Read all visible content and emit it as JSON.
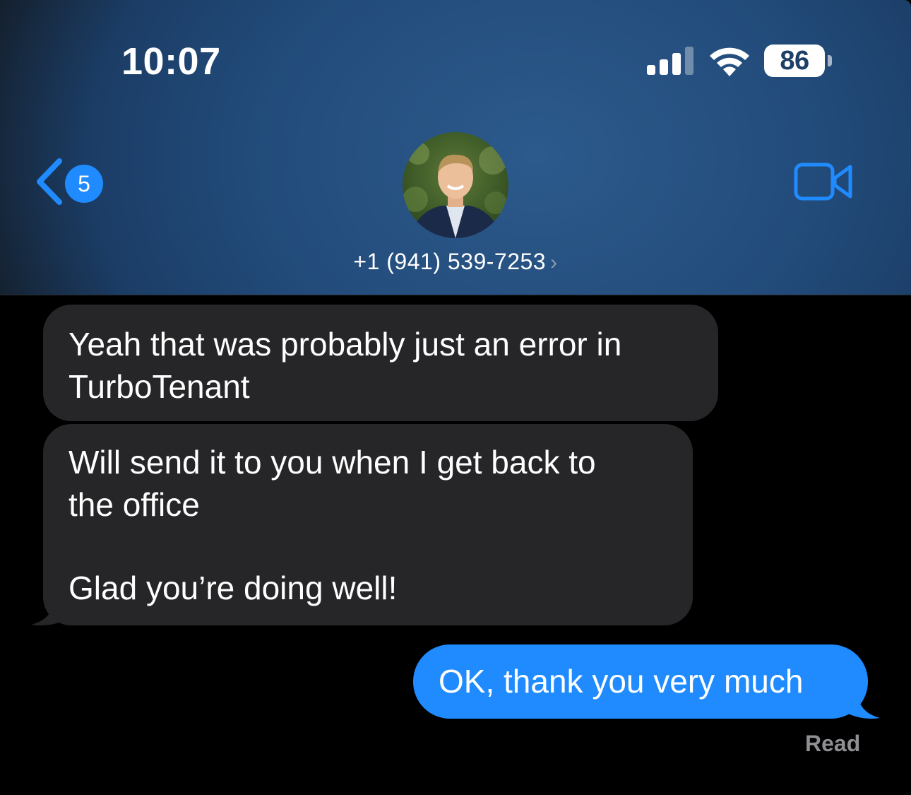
{
  "status_bar": {
    "time": "10:07",
    "battery_level": "86",
    "icons": [
      "signal-icon",
      "wifi-icon",
      "battery-icon"
    ]
  },
  "nav": {
    "back_badge_count": "5",
    "contact": "+1 (941) 539-7253",
    "contact_chevron": "›",
    "icons": [
      "back-chevron-icon",
      "video-call-icon",
      "contact-avatar"
    ]
  },
  "messages": [
    {
      "direction": "incoming",
      "lines": [
        "Yeah that was probably just an error in",
        "TurboTenant"
      ]
    },
    {
      "direction": "incoming",
      "paragraph1": [
        "Will send it to you when I get back to",
        "the office"
      ],
      "paragraph2": "Glad you’re doing well!"
    },
    {
      "direction": "outgoing",
      "text": "OK, thank you very much",
      "receipt": "Read"
    }
  ],
  "colors": {
    "outgoing_bubble": "#1f8bff",
    "incoming_bubble": "#262629",
    "accent": "#1f8bff",
    "header": "#224b7a"
  }
}
